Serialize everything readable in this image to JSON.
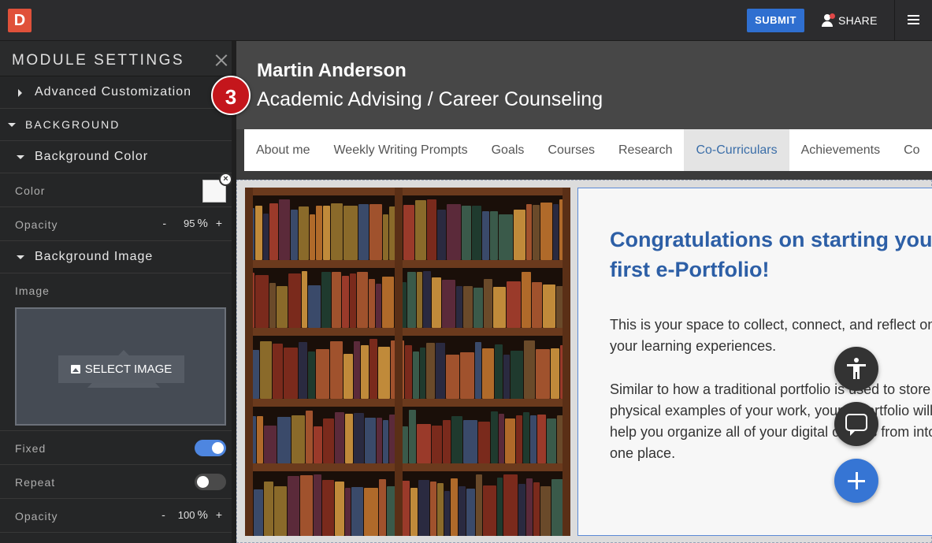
{
  "app": {
    "logo_letter": "D"
  },
  "topbar": {
    "submit_label": "SUBMIT",
    "share_label": "SHARE",
    "menu_icon": "hamburger-icon"
  },
  "sidebar": {
    "title": "MODULE SETTINGS",
    "advanced": "Advanced Customization",
    "background_header": "BACKGROUND",
    "bg_color_section": "Background Color",
    "color_label": "Color",
    "color_value": "#f7f7f7",
    "color_opacity_label": "Opacity",
    "color_opacity_value": "95",
    "bg_image_section": "Background Image",
    "image_label": "Image",
    "select_image": "SELECT IMAGE",
    "fixed_label": "Fixed",
    "fixed_on": true,
    "repeat_label": "Repeat",
    "repeat_on": false,
    "image_opacity_label": "Opacity",
    "image_opacity_value": "100",
    "minus": "-",
    "plus": "+",
    "percent": "%"
  },
  "step_badge": "3",
  "profile": {
    "name": "Martin Anderson",
    "role": "Academic Advising / Career Counseling"
  },
  "nav": {
    "tabs": [
      "About me",
      "Weekly Writing Prompts",
      "Goals",
      "Courses",
      "Research",
      "Co-Curriculars",
      "Achievements",
      "Co"
    ],
    "active_index": 5
  },
  "card": {
    "title": "Congratulations on starting your first e-Portfolio!",
    "p1": "This is your space to collect, connect, and reflect on your learning experiences.",
    "p2": "Similar to how a traditional portfolio is used to store physical examples of your work, your e-portfolio will help you organize all of your digital objects from into one place."
  },
  "fabs": {
    "accessibility": "accessibility-icon",
    "chat": "chat-icon",
    "add": "plus-icon"
  }
}
